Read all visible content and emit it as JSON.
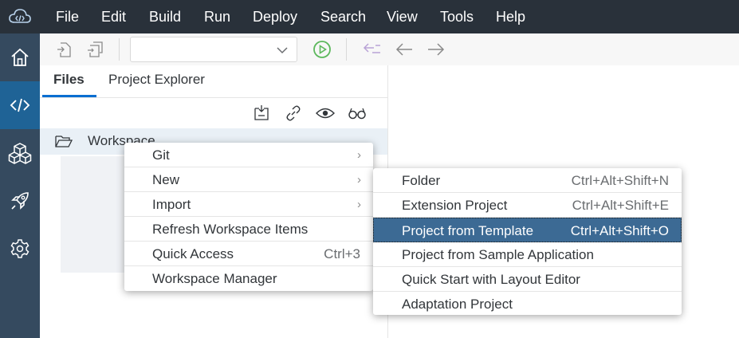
{
  "menubar": {
    "items": [
      "File",
      "Edit",
      "Build",
      "Run",
      "Deploy",
      "Search",
      "View",
      "Tools",
      "Help"
    ]
  },
  "rail": {
    "icons": [
      "home-icon",
      "code-icon",
      "cubes-icon",
      "rocket-icon",
      "settings-icon"
    ],
    "active": "code-icon"
  },
  "toolbar": {
    "run_configuration_value": "",
    "icons": [
      "new-file-icon",
      "copy-file-icon",
      "chevron-down-icon",
      "run-icon",
      "back-list-icon",
      "arrow-left-icon",
      "arrow-right-icon"
    ]
  },
  "pane": {
    "tabs": [
      "Files",
      "Project Explorer"
    ],
    "active_tab": "Files",
    "actions": [
      "collapse-all-icon",
      "link-icon",
      "eye-icon",
      "glasses-icon"
    ],
    "workspace_label": "Workspace"
  },
  "context_menu": {
    "items": [
      {
        "label": "Git",
        "shortcut": "",
        "submenu": true
      },
      {
        "label": "New",
        "shortcut": "",
        "submenu": true
      },
      {
        "label": "Import",
        "shortcut": "",
        "submenu": true
      },
      {
        "label": "Refresh Workspace Items",
        "shortcut": "",
        "submenu": false
      },
      {
        "label": "Quick Access",
        "shortcut": "Ctrl+3",
        "submenu": false
      },
      {
        "label": "Workspace Manager",
        "shortcut": "",
        "submenu": false
      }
    ]
  },
  "submenu_new": {
    "items": [
      {
        "label": "Folder",
        "shortcut": "Ctrl+Alt+Shift+N"
      },
      {
        "label": "Extension Project",
        "shortcut": "Ctrl+Alt+Shift+E"
      },
      {
        "label": "Project from Template",
        "shortcut": "Ctrl+Alt+Shift+O"
      },
      {
        "label": "Project from Sample Application",
        "shortcut": ""
      },
      {
        "label": "Quick Start with Layout Editor",
        "shortcut": ""
      },
      {
        "label": "Adaptation Project",
        "shortcut": ""
      }
    ],
    "highlighted": "Project from Template"
  },
  "colors": {
    "menubar_bg": "#29313a",
    "rail_bg": "#354a5f",
    "rail_active": "#1f6396",
    "accent": "#0a6ed1",
    "run_green": "#5cb85c",
    "highlight": "#3c6a94"
  }
}
